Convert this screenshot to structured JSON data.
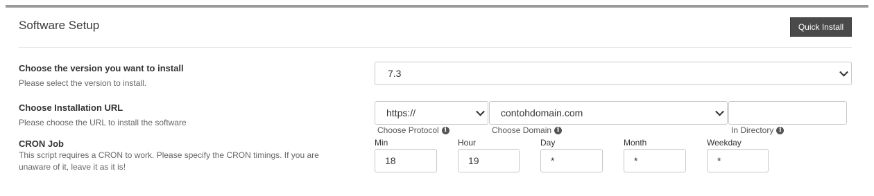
{
  "header": {
    "title": "Software Setup",
    "quick_install_label": "Quick Install"
  },
  "version": {
    "label": "Choose the version you want to install",
    "help": "Please select the version to install.",
    "selected": "7.3"
  },
  "install_url": {
    "label": "Choose Installation URL",
    "help": "Please choose the URL to install the software",
    "protocol": {
      "selected": "https://",
      "caption": "Choose Protocol"
    },
    "domain": {
      "selected": "contohdomain.com",
      "caption": "Choose Domain"
    },
    "directory": {
      "value": "",
      "caption": "In Directory"
    }
  },
  "cron": {
    "label": "CRON Job",
    "help": "This script requires a CRON to work. Please specify the CRON timings. If you are unaware of it, leave it as it is!",
    "fields": [
      {
        "label": "Min",
        "value": "18"
      },
      {
        "label": "Hour",
        "value": "19"
      },
      {
        "label": "Day",
        "value": "*"
      },
      {
        "label": "Month",
        "value": "*"
      },
      {
        "label": "Weekday",
        "value": "*"
      }
    ]
  },
  "colors": {
    "button_bg": "#4a4a4a",
    "top_border": "#9a9a9a"
  },
  "icons": [
    "chevron-down-icon",
    "info-icon"
  ]
}
